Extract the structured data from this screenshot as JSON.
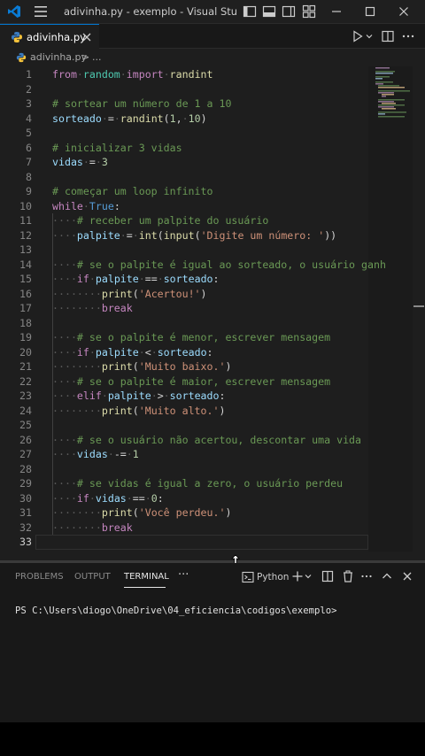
{
  "window": {
    "title": "adivinha.py - exemplo - Visual Studio C...",
    "logo_icon": "vscode-logo-icon",
    "menu_icon": "hamburger-menu-icon",
    "controls": [
      "toggle-primary-sidebar-icon",
      "toggle-panel-icon",
      "toggle-secondary-sidebar-icon",
      "customize-layout-icon",
      "minimize-icon",
      "maximize-icon",
      "close-icon"
    ]
  },
  "tabs": [
    {
      "label": "adivinha.py",
      "active": true
    }
  ],
  "tab_actions": [
    "run-icon",
    "split-editor-icon",
    "more-actions-icon"
  ],
  "breadcrumb": {
    "file": "adivinha.py",
    "separator": ">",
    "more": "..."
  },
  "editor": {
    "lines": [
      {
        "n": "1",
        "text": "from random import randint"
      },
      {
        "n": "2",
        "text": ""
      },
      {
        "n": "3",
        "text": "# sortear um número de 1 a 10"
      },
      {
        "n": "4",
        "text": "sorteado = randint(1, 10)"
      },
      {
        "n": "5",
        "text": ""
      },
      {
        "n": "6",
        "text": "# inicializar 3 vidas"
      },
      {
        "n": "7",
        "text": "vidas = 3"
      },
      {
        "n": "8",
        "text": ""
      },
      {
        "n": "9",
        "text": "# começar um loop infinito"
      },
      {
        "n": "10",
        "text": "while True:"
      },
      {
        "n": "11",
        "text": "    # receber um palpite do usuário"
      },
      {
        "n": "12",
        "text": "    palpite = int(input('Digite um número: '))"
      },
      {
        "n": "13",
        "text": ""
      },
      {
        "n": "14",
        "text": "    # se o palpite é igual ao sorteado, o usuário ganh"
      },
      {
        "n": "15",
        "text": "    if palpite == sorteado:"
      },
      {
        "n": "16",
        "text": "        print('Acertou!')"
      },
      {
        "n": "17",
        "text": "        break"
      },
      {
        "n": "18",
        "text": ""
      },
      {
        "n": "19",
        "text": "    # se o palpite é menor, escrever mensagem"
      },
      {
        "n": "20",
        "text": "    if palpite < sorteado:"
      },
      {
        "n": "21",
        "text": "        print('Muito baixo.')"
      },
      {
        "n": "22",
        "text": "    # se o palpite é maior, escrever mensagem"
      },
      {
        "n": "23",
        "text": "    elif palpite > sorteado:"
      },
      {
        "n": "24",
        "text": "        print('Muito alto.')"
      },
      {
        "n": "25",
        "text": ""
      },
      {
        "n": "26",
        "text": "    # se o usuário não acertou, descontar uma vida"
      },
      {
        "n": "27",
        "text": "    vidas -= 1"
      },
      {
        "n": "28",
        "text": ""
      },
      {
        "n": "29",
        "text": "    # se vidas é igual a zero, o usuário perdeu"
      },
      {
        "n": "30",
        "text": "    if vidas == 0:"
      },
      {
        "n": "31",
        "text": "        print('Você perdeu.')"
      },
      {
        "n": "32",
        "text": "        break"
      },
      {
        "n": "33",
        "text": ""
      }
    ]
  },
  "panel": {
    "tabs": [
      "PROBLEMS",
      "OUTPUT",
      "TERMINAL"
    ],
    "active_tab": "TERMINAL",
    "more": "···",
    "terminal_name": "Python",
    "actions": [
      "new-terminal-icon",
      "launch-profile-chevron-icon",
      "split-terminal-icon",
      "kill-terminal-icon",
      "more-actions-icon",
      "maximize-panel-icon",
      "close-panel-icon"
    ],
    "terminal_prompt": "PS C:\\Users\\diogo\\OneDrive\\04_eficiencia\\codigos\\exemplo>"
  },
  "colors": {
    "accent": "#0078d4",
    "keyword": "#c586c0",
    "string": "#ce9178",
    "comment": "#6a9955",
    "function": "#dcdcaa",
    "number": "#b5cea8"
  }
}
